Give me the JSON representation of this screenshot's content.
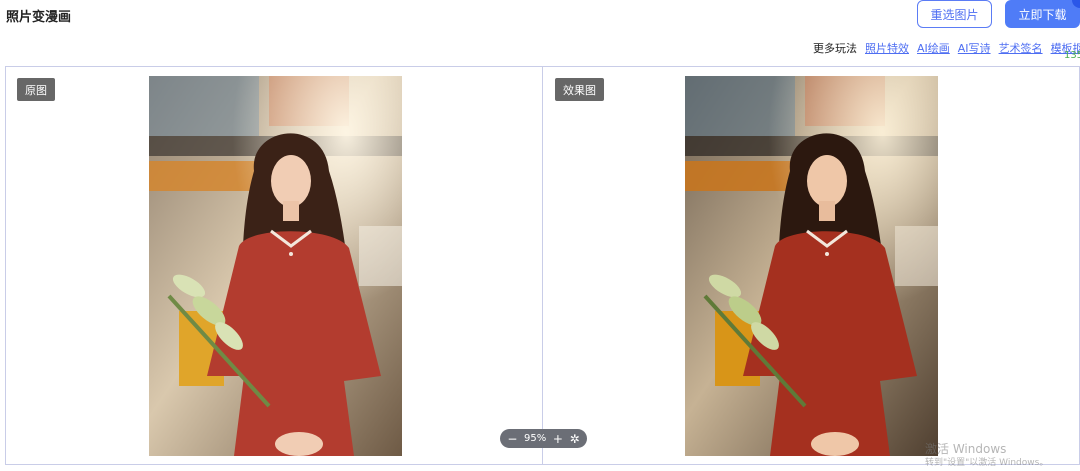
{
  "header": {
    "title": "照片变漫画",
    "reselect_label": "重选图片",
    "download_label": "立即下载"
  },
  "more": {
    "label": "更多玩法",
    "links": [
      "照片特效",
      "AI绘画",
      "AI写诗",
      "艺术签名",
      "模板抠图"
    ],
    "clipped_number": "135"
  },
  "compare": {
    "original_tag": "原图",
    "result_tag": "效果图"
  },
  "zoom": {
    "minus": "−",
    "level": "95%",
    "plus": "+",
    "reset_icon": "reset-icon"
  },
  "watermark": {
    "line1": "激活 Windows",
    "line2": "转到\"设置\"以激活 Windows。"
  },
  "colors": {
    "accent": "#4f7cf7",
    "tag_bg": "#676767",
    "border": "#c9cde8"
  }
}
